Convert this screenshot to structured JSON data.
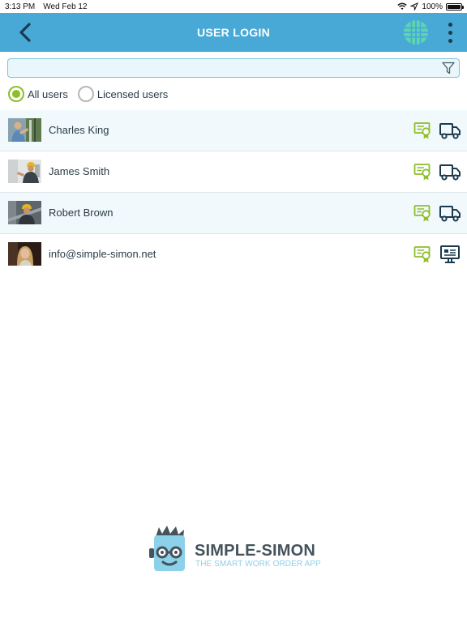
{
  "status_bar": {
    "time": "3:13 PM",
    "date": "Wed Feb 12",
    "battery": "100%"
  },
  "header": {
    "title": "USER LOGIN"
  },
  "search": {
    "value": "",
    "placeholder": ""
  },
  "filter": {
    "options": [
      "All users",
      "Licensed users"
    ],
    "selected": "All users"
  },
  "users": [
    {
      "name": "Charles King",
      "license_icon": "license-certificate-icon",
      "type_icon": "truck-icon"
    },
    {
      "name": "James Smith",
      "license_icon": "license-certificate-icon",
      "type_icon": "truck-icon"
    },
    {
      "name": "Robert Brown",
      "license_icon": "license-certificate-icon",
      "type_icon": "truck-icon"
    },
    {
      "name": "info@simple-simon.net",
      "license_icon": "license-certificate-icon",
      "type_icon": "desktop-monitor-icon"
    }
  ],
  "logo": {
    "brand": "SIMPLE-SIMON",
    "tagline": "THE SMART WORK ORDER APP"
  },
  "colors": {
    "header": "#48a9d6",
    "accent_green": "#8cbf2a",
    "icon_dark": "#1b3a4e",
    "logo_blue": "#8cd0ea"
  }
}
